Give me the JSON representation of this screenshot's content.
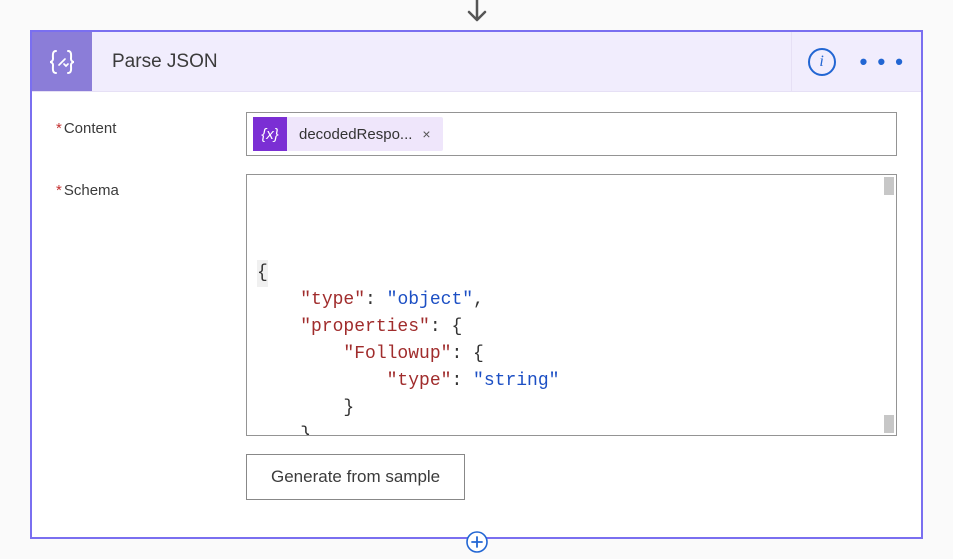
{
  "header": {
    "title": "Parse JSON",
    "info_label": "i",
    "more_label": "• • •"
  },
  "fields": {
    "content": {
      "label": "Content",
      "token": {
        "icon_text": "{x}",
        "label": "decodedRespo...",
        "close": "×"
      }
    },
    "schema": {
      "label": "Schema",
      "code": {
        "l1": "{",
        "l2_key": "\"type\"",
        "l2_val": "\"object\"",
        "l3_key": "\"properties\"",
        "l4_key": "\"Followup\"",
        "l5_key": "\"type\"",
        "l5_val": "\"string\"",
        "l6": "}",
        "l7": "}",
        "l8": "}"
      }
    }
  },
  "actions": {
    "generate_from_sample": "Generate from sample"
  }
}
